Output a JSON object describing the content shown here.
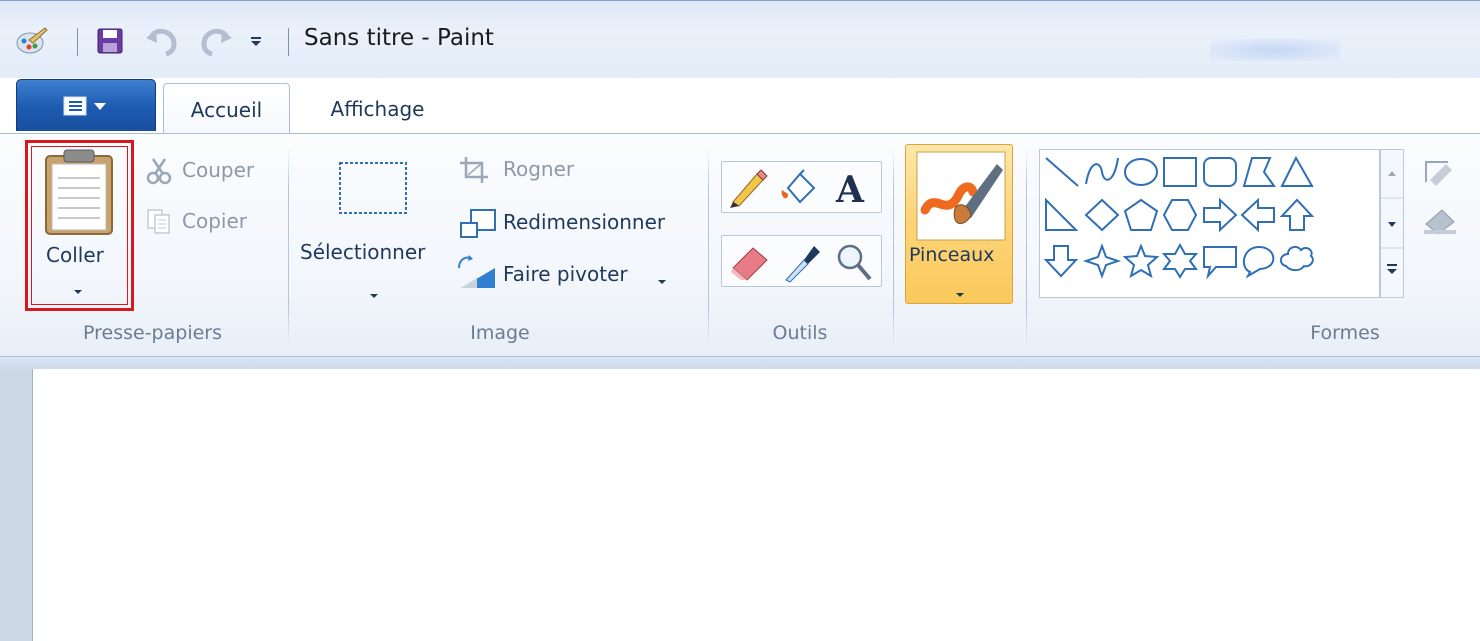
{
  "window": {
    "title": "Sans titre - Paint"
  },
  "quick_access": {
    "items": [
      "paint-app-icon",
      "save-icon",
      "undo-icon",
      "redo-icon",
      "customize-qat-icon"
    ]
  },
  "tabs": [
    {
      "label": "Accueil",
      "active": true
    },
    {
      "label": "Affichage",
      "active": false
    }
  ],
  "ribbon": {
    "clipboard": {
      "paste_label": "Coller",
      "cut_label": "Couper",
      "copy_label": "Copier",
      "group_label": "Presse-papiers"
    },
    "image": {
      "select_label": "Sélectionner",
      "crop_label": "Rogner",
      "resize_label": "Redimensionner",
      "rotate_label": "Faire pivoter",
      "group_label": "Image"
    },
    "tools": {
      "group_label": "Outils",
      "items": [
        "pencil-icon",
        "fill-bucket-icon",
        "text-icon",
        "eraser-icon",
        "color-picker-icon",
        "magnifier-icon"
      ]
    },
    "brushes": {
      "label": "Pinceaux"
    },
    "shapes": {
      "group_label": "Formes"
    }
  },
  "colors": {
    "accent_blue": "#1c5bb0",
    "highlight_red": "#d7191f",
    "active_orange": "#fbc95b",
    "shape_stroke": "#2f6fb5"
  }
}
